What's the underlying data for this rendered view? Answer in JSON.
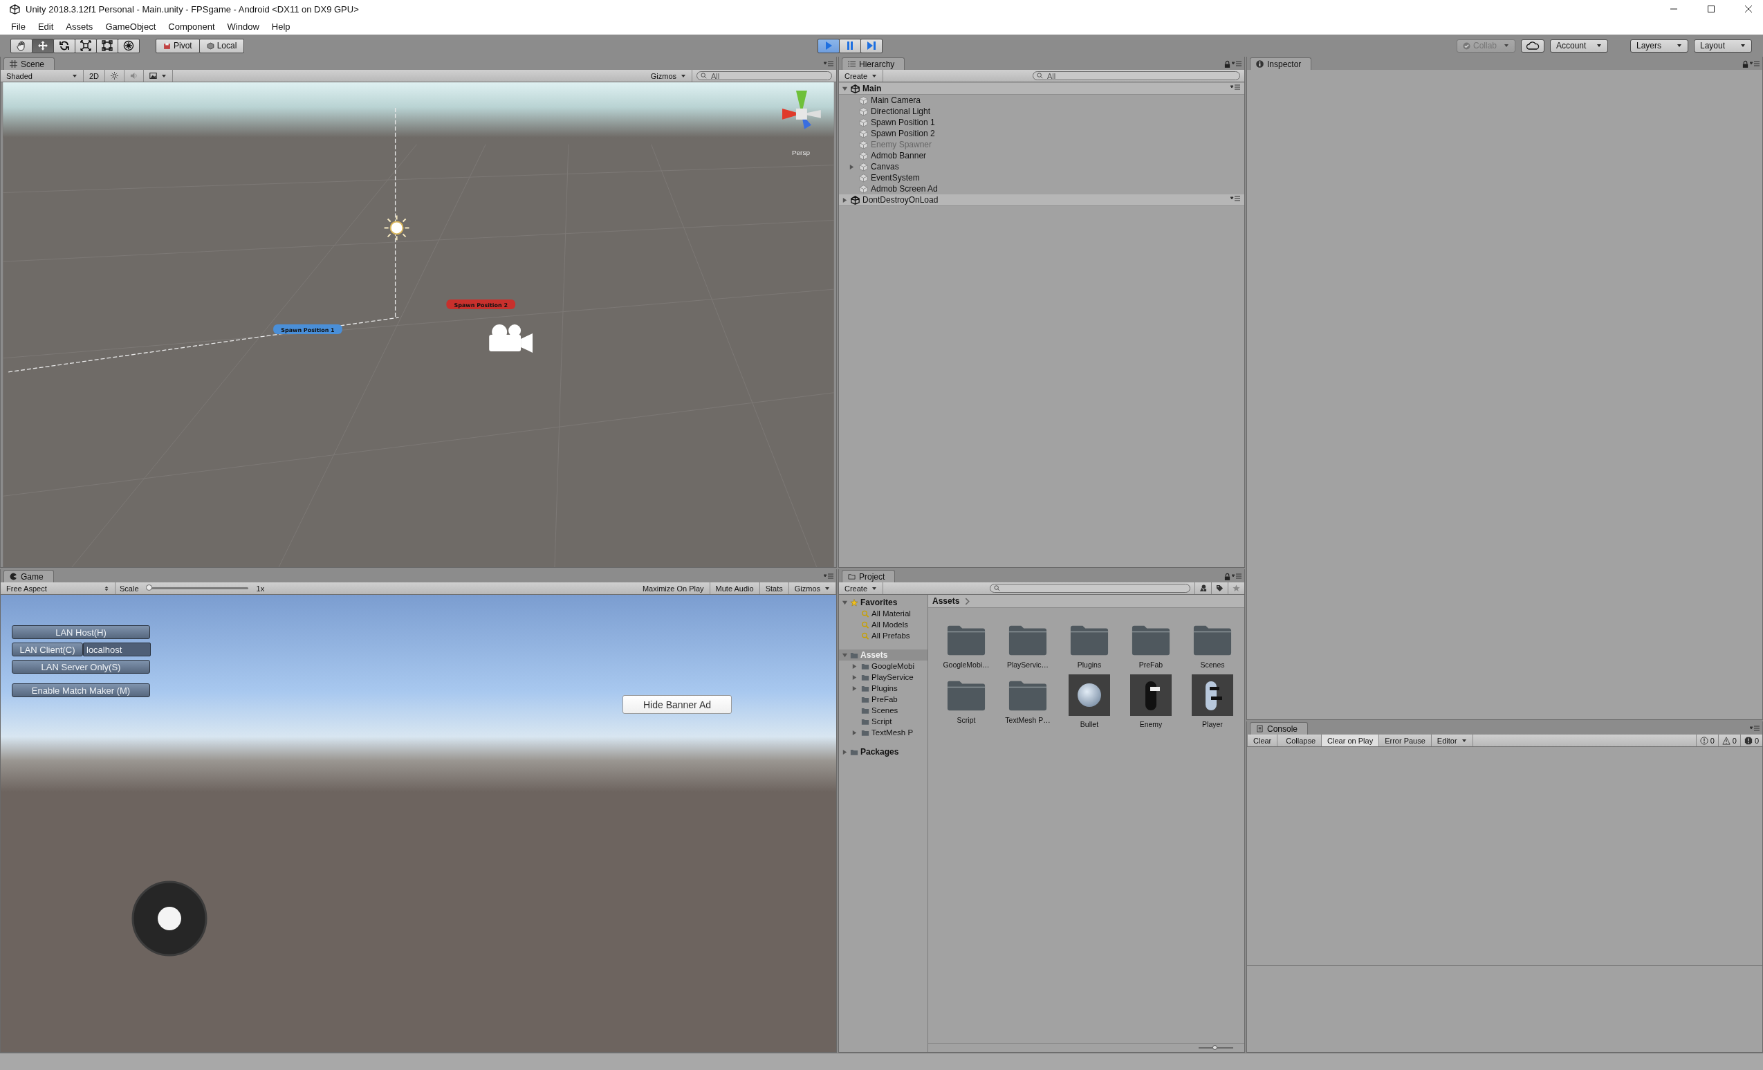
{
  "window": {
    "title": "Unity 2018.3.12f1 Personal - Main.unity - FPSgame - Android <DX11 on DX9 GPU>"
  },
  "menu": [
    "File",
    "Edit",
    "Assets",
    "GameObject",
    "Component",
    "Window",
    "Help"
  ],
  "toolbar": {
    "tools": [
      {
        "kind": "hand",
        "selected": false
      },
      {
        "kind": "move",
        "selected": true
      },
      {
        "kind": "rotate",
        "selected": false
      },
      {
        "kind": "scale",
        "selected": false
      },
      {
        "kind": "rect",
        "selected": false
      },
      {
        "kind": "transform",
        "selected": false
      }
    ],
    "pivot": "Pivot",
    "local": "Local",
    "playback": [
      {
        "kind": "play",
        "on": true
      },
      {
        "kind": "pause",
        "on": false
      },
      {
        "kind": "step",
        "on": false
      }
    ],
    "collab": {
      "label": "Collab",
      "disabled": true
    },
    "account": "Account",
    "layers": "Layers",
    "layout": "Layout"
  },
  "scene": {
    "tab": "Scene",
    "shading": "Shaded",
    "mode_2d": "2D",
    "lighting": {
      "on": false
    },
    "audio": {
      "on": false
    },
    "gizmos": "Gizmos",
    "search": {
      "placeholder": "All"
    },
    "labels": [
      {
        "text": "Spawn Position 2",
        "color": "#c8302c"
      },
      {
        "text": "Spawn Position 1",
        "color": "#4a8fd8"
      }
    ],
    "persp": "Persp"
  },
  "game": {
    "tab": "Game",
    "aspect": "Free Aspect",
    "scale_label": "Scale",
    "scale": {
      "level": 0.0,
      "reading": "1x"
    },
    "toggles": [
      {
        "label": "Maximize On Play",
        "on": false
      },
      {
        "label": "Mute Audio",
        "on": false
      },
      {
        "label": "Stats",
        "on": false
      }
    ],
    "gizmos": "Gizmos",
    "menu": [
      {
        "kind": "button",
        "label": "LAN Host(H)"
      },
      {
        "kind": "client",
        "label": "LAN Client(C)",
        "value": "localhost"
      },
      {
        "kind": "button",
        "label": "LAN Server Only(S)"
      },
      {
        "kind": "matchmaker",
        "label": "Enable Match Maker (M)"
      }
    ],
    "banner_button": "Hide Banner Ad"
  },
  "hierarchy": {
    "tab": "Hierarchy",
    "create": "Create",
    "search": {
      "placeholder": "All"
    },
    "scenes": [
      {
        "name": "Main",
        "expanded": true,
        "children": [
          {
            "name": "Main Camera",
            "active": true,
            "collapsible": false
          },
          {
            "name": "Directional Light",
            "active": true,
            "collapsible": false
          },
          {
            "name": "Spawn Position 1",
            "active": true,
            "collapsible": false
          },
          {
            "name": "Spawn Position 2",
            "active": true,
            "collapsible": false
          },
          {
            "name": "Enemy Spawner",
            "active": false,
            "collapsible": false
          },
          {
            "name": "Admob Banner",
            "active": true,
            "collapsible": false
          },
          {
            "name": "Canvas",
            "active": true,
            "collapsible": true
          },
          {
            "name": "EventSystem",
            "active": true,
            "collapsible": false
          },
          {
            "name": "Admob Screen Ad",
            "active": true,
            "collapsible": false
          }
        ]
      },
      {
        "name": "DontDestroyOnLoad",
        "expanded": false
      }
    ]
  },
  "inspector": {
    "tab": "Inspector"
  },
  "project": {
    "tab": "Project",
    "create": "Create",
    "tree": [
      {
        "name": "Favorites",
        "kind": "favorites",
        "expanded": true,
        "selected": false,
        "children": [
          {
            "name": "All Material",
            "kind": "search",
            "collapsible": false,
            "selected": false
          },
          {
            "name": "All Models",
            "kind": "search",
            "collapsible": false,
            "selected": false
          },
          {
            "name": "All Prefabs",
            "kind": "search",
            "collapsible": false,
            "selected": false
          }
        ]
      },
      {
        "name": "Assets",
        "kind": "folder",
        "expanded": true,
        "selected": true,
        "children": [
          {
            "name": "GoogleMobi",
            "kind": "folder",
            "collapsible": true,
            "selected": false
          },
          {
            "name": "PlayService",
            "kind": "folder",
            "collapsible": true,
            "selected": false
          },
          {
            "name": "Plugins",
            "kind": "folder",
            "collapsible": true,
            "selected": false
          },
          {
            "name": "PreFab",
            "kind": "folder",
            "collapsible": false,
            "selected": false
          },
          {
            "name": "Scenes",
            "kind": "folder",
            "collapsible": false,
            "selected": false
          },
          {
            "name": "Script",
            "kind": "folder",
            "collapsible": false,
            "selected": false
          },
          {
            "name": "TextMesh P",
            "kind": "folder",
            "collapsible": true,
            "selected": false
          }
        ]
      },
      {
        "name": "Packages",
        "kind": "folder",
        "expanded": false,
        "selected": false
      }
    ],
    "breadcrumb": "Assets",
    "items": [
      {
        "name": "GoogleMobi…",
        "kind": "folder"
      },
      {
        "name": "PlayServic…",
        "kind": "folder"
      },
      {
        "name": "Plugins",
        "kind": "folder"
      },
      {
        "name": "PreFab",
        "kind": "folder"
      },
      {
        "name": "Scenes",
        "kind": "folder"
      },
      {
        "name": "Script",
        "kind": "folder"
      },
      {
        "name": "TextMesh P…",
        "kind": "folder"
      },
      {
        "name": "Bullet",
        "kind": "sphere"
      },
      {
        "name": "Enemy",
        "kind": "enemy"
      },
      {
        "name": "Player",
        "kind": "player"
      }
    ],
    "icon_size": {
      "level": 0.45
    }
  },
  "console": {
    "tab": "Console",
    "buttons": [
      {
        "label": "Clear",
        "kind": "button",
        "on": false
      },
      {
        "label": "Collapse",
        "kind": "toggle",
        "on": false
      },
      {
        "label": "Clear on Play",
        "kind": "toggle",
        "on": true
      },
      {
        "label": "Error Pause",
        "kind": "toggle",
        "on": false
      },
      {
        "label": "Editor",
        "kind": "dropdown",
        "on": false
      }
    ],
    "counts": [
      {
        "kind": "info",
        "count": "0"
      },
      {
        "kind": "warning",
        "count": "0"
      },
      {
        "kind": "error",
        "count": "0"
      }
    ]
  }
}
